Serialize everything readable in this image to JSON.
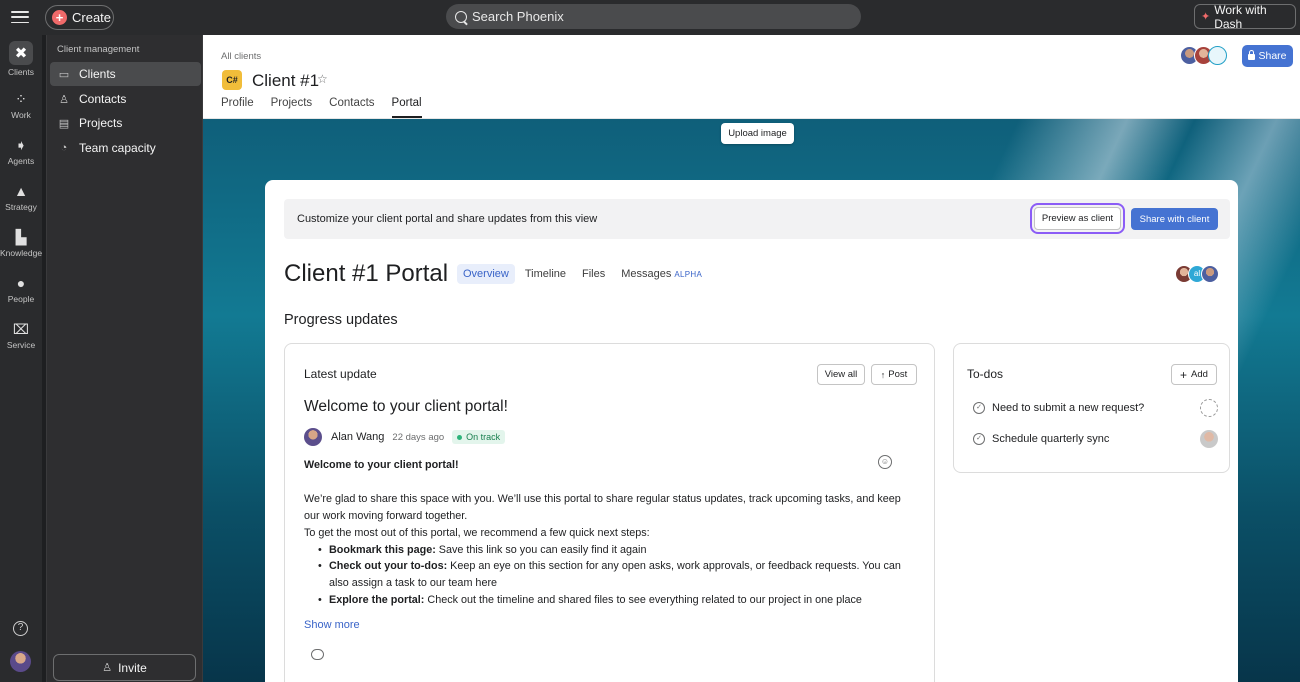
{
  "topbar": {
    "create_label": "Create",
    "search_placeholder": "Search Phoenix",
    "dash_label": "Work with Dash"
  },
  "rail": {
    "items": [
      {
        "label": "Clients",
        "icon": "clients-icon"
      },
      {
        "label": "Work",
        "icon": "work-icon"
      },
      {
        "label": "Agents",
        "icon": "agents-icon"
      },
      {
        "label": "Strategy",
        "icon": "strategy-icon"
      },
      {
        "label": "Knowledge",
        "icon": "knowledge-icon"
      },
      {
        "label": "People",
        "icon": "people-icon"
      },
      {
        "label": "Service",
        "icon": "service-icon"
      }
    ]
  },
  "sidebar": {
    "heading": "Client management",
    "items": [
      {
        "label": "Clients",
        "icon": "briefcase-icon"
      },
      {
        "label": "Contacts",
        "icon": "contact-icon"
      },
      {
        "label": "Projects",
        "icon": "clipboard-icon"
      },
      {
        "label": "Team capacity",
        "icon": "gauge-icon"
      }
    ],
    "invite_label": "Invite"
  },
  "header": {
    "breadcrumb": "All clients",
    "project_icon_text": "C#",
    "title": "Client #1",
    "tabs": [
      "Profile",
      "Projects",
      "Contacts",
      "Portal"
    ],
    "active_tab": "Portal",
    "share_label": "Share"
  },
  "banner": {
    "upload_label": "Upload image"
  },
  "portal": {
    "notice_text": "Customize your client portal and share updates from this view",
    "preview_label": "Preview as client",
    "share_client_label": "Share with client",
    "title": "Client #1 Portal",
    "tabs": [
      "Overview",
      "Timeline",
      "Files",
      "Messages"
    ],
    "alpha_badge": "ALPHA",
    "avatar_initials": "al",
    "section_title": "Progress updates"
  },
  "update": {
    "heading": "Latest update",
    "view_all_label": "View all",
    "post_label": "Post",
    "title": "Welcome to your client portal!",
    "author": "Alan Wang",
    "time": "22 days ago",
    "status": "On track",
    "body_heading": "Welcome to your client portal!",
    "para1": "We’re glad to share this space with you. We’ll use this portal to share regular status updates, track upcoming tasks, and keep our work moving forward together.",
    "para2": "To get the most out of this portal, we recommend a few quick next steps:",
    "bullets": [
      {
        "bold": "Bookmark this page:",
        "text": " Save this link so you can easily find it again"
      },
      {
        "bold": "Check out your to-dos:",
        "text": " Keep an eye on this section for any open asks, work approvals, or feedback requests. You can also assign a task to our team here"
      },
      {
        "bold": "Explore the portal:",
        "text": " Check out the timeline and shared files to see everything related to our project in one place"
      }
    ],
    "show_more_label": "Show more"
  },
  "todos": {
    "heading": "To-dos",
    "add_label": "Add",
    "items": [
      {
        "label": "Need to submit a new request?"
      },
      {
        "label": "Schedule quarterly sync"
      }
    ]
  },
  "colors": {
    "accent_blue": "#4573d2",
    "status_green": "#2db37a",
    "create_red": "#f06a6a",
    "project_yellow": "#f1bd3a",
    "highlight_purple": "#8b5cf6"
  }
}
